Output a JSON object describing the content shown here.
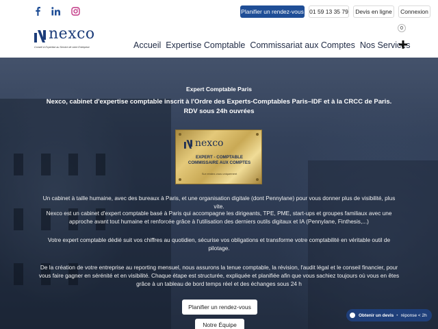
{
  "topbar": {
    "social": [
      {
        "icon": "facebook-icon",
        "glyph": "f"
      },
      {
        "icon": "linkedin-icon",
        "glyph": "in"
      },
      {
        "icon": "instagram-icon"
      }
    ],
    "rdv_label": "Planifier un rendez-vous",
    "phone": "01 59 13 35 79",
    "devis_label": "Devis en ligne",
    "login_label": "Connexion"
  },
  "header": {
    "logo_text": "nexco",
    "logo_tagline": "Conseil & Expertise au Service de votre Entreprise",
    "cart_count": "0",
    "nav": [
      "Accueil",
      "Expertise Comptable",
      "Commissariat aux Comptes",
      "Nos Services"
    ]
  },
  "hero": {
    "title": "Expert Comptable Paris",
    "subtitle_line1": "Nexco, cabinet d'expertise comptable inscrit à l'Ordre des Experts-Comptables Paris–IDF et à la CRCC de Paris.",
    "subtitle_line2": "RDV sous 24h ouvrées",
    "plaque": {
      "logo_text": "nexco",
      "line1": "EXPERT - COMPTABLE",
      "line2": "COMMISSAIRE AUX COMPTES",
      "line3": "Sur rendez-vous uniquement"
    },
    "text1": "Un cabinet à taille humaine, avec des bureaux à Paris, et une organisation digitale (dont Pennylane) pour vous donner plus de visibilité, plus vite.",
    "text2": "Nexco est un cabinet d'expert comptable basé à Paris qui accompagne les dirigeants, TPE, PME, start-ups et groupes familiaux avec une approche avant tout humaine et renforcée grâce à l'utilisation des derniers outils digitaux et IA (Pennylane, Finthesis,...)",
    "text3": "Votre expert comptable dédié suit vos chiffres au quotidien, sécurise vos obligations et transforme votre comptabilité en véritable outil de pilotage.",
    "text4": "De la création de votre entreprise au reporting mensuel, nous assurons la tenue comptable, la révision, l'audit légal et le conseil financier, pour vous faire gagner en sérénité et en visibilité. Chaque étape est structurée, expliquée et planifiée afin que vous sachiez toujours où vous en êtes grâce à un tableau de bord temps réel et des échanges sous 24 h",
    "cta_rdv": "Planifier un rendez-vous",
    "cta_team": "Notre Équipe"
  },
  "chat": {
    "label": "Obtenir un devis",
    "sublabel": "réponse < 2h"
  },
  "colors": {
    "brand": "#1f4e96",
    "navy": "#1d3d7a"
  }
}
